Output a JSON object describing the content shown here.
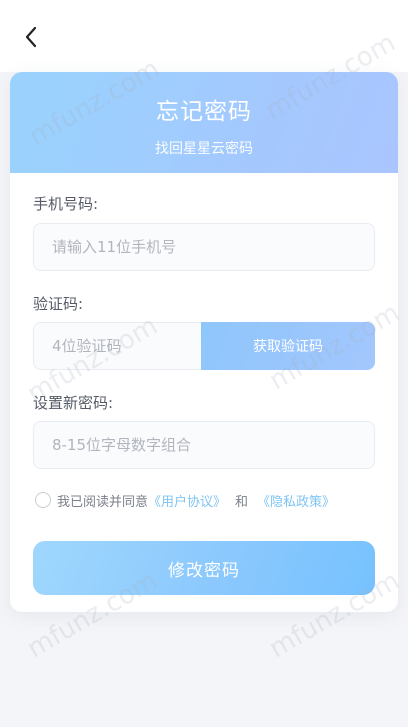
{
  "header": {
    "back_icon": "chevron-left-icon"
  },
  "card": {
    "title": "忘记密码",
    "subtitle": "找回星星云密码"
  },
  "form": {
    "phone_label": "手机号码:",
    "phone_placeholder": "请输入11位手机号",
    "code_label": "验证码:",
    "code_placeholder": "4位验证码",
    "get_code_label": "获取验证码",
    "password_label": "设置新密码:",
    "password_placeholder": "8-15位字母数字组合"
  },
  "agreement": {
    "prefix": "我已阅读并同意",
    "user_agreement": "《用户协议》",
    "and": "和",
    "privacy_policy": "《隐私政策》"
  },
  "submit": {
    "label": "修改密码"
  },
  "watermark": {
    "text": "mfunz.com"
  },
  "colors": {
    "accent": "#8ec6fc",
    "link": "#7fc4f3"
  }
}
